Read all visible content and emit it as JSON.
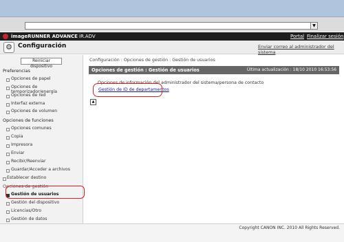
{
  "header": {
    "brand": "imageRUNNER ADVANCE",
    "device": "iR.ADV",
    "portal": "Portal",
    "logout": "Finalizar sesión"
  },
  "titlebar": {
    "title": "Configuración",
    "send_link": "Enviar correo al administrador del sistema"
  },
  "sidebar": {
    "reset_label": "Reiniciar dispositivo",
    "preferencias": "Preferencias",
    "pref_items": [
      "Opciones de papel",
      "Opciones de temporizador/energía",
      "Opciones de red",
      "Interfaz externa",
      "Opciones de volumen"
    ],
    "funciones": "Opciones de funciones",
    "func_items": [
      "Opciones comunes",
      "Copia",
      "Impresora",
      "Enviar",
      "Recibir/Reenviar",
      "Guardar/Acceder a archivos"
    ],
    "destino": "Establecer destino",
    "gestion": "Opciones de gestión",
    "gest_items": [
      "Gestión de usuarios",
      "Gestión del dispositivo",
      "Licencias/Otro",
      "Gestión de datos"
    ]
  },
  "main": {
    "breadcrumb": "Configuración : Opciones de gestión : Gestión de usuarios",
    "section_title": "Opciones de gestión : Gestión de usuarios",
    "last_update": "Última actualización : 18/10 2010 16:53:56",
    "link_info": "Opciones de información del administrador del sistema/persona de contacto",
    "link_dept": "Gestión de ID de departamentos"
  },
  "footer": {
    "copyright": "Copyright CANON INC. 2010 All Rights Reserved."
  }
}
